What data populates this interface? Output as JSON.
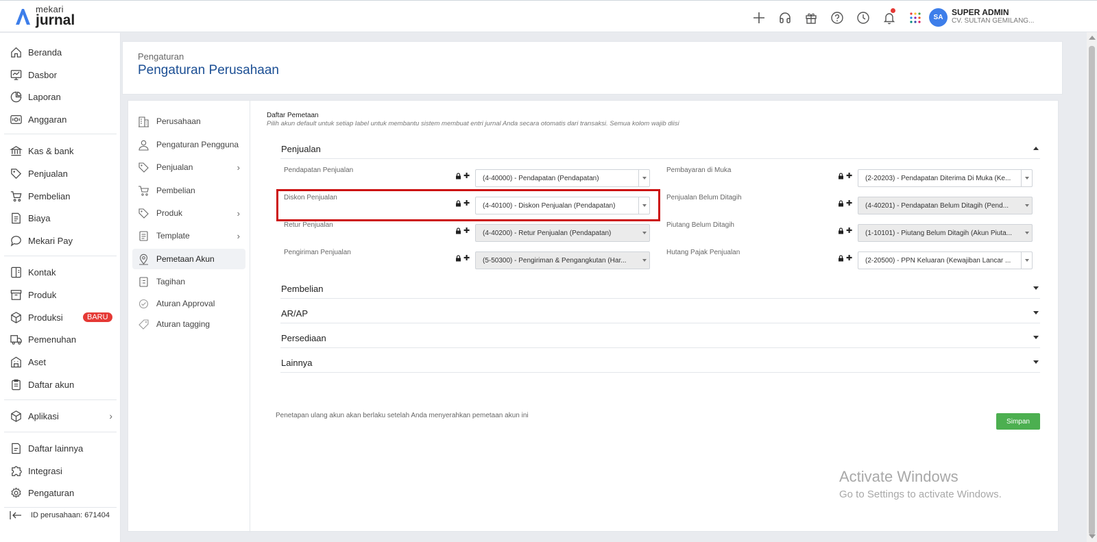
{
  "app": {
    "logo_small": "mekari",
    "logo_big": "jurnal"
  },
  "topbar": {
    "icons": [
      "plus-icon",
      "headset-icon",
      "gift-icon",
      "help-icon",
      "clock-icon",
      "bell-icon",
      "apps-grid-icon"
    ],
    "avatar_initials": "SA",
    "user_name": "SUPER ADMIN",
    "company_name": "CV. SULTAN GEMILANG..."
  },
  "sidebar": {
    "items": [
      {
        "label": "Beranda",
        "icon": "home-icon"
      },
      {
        "label": "Dasbor",
        "icon": "dashboard-icon"
      },
      {
        "label": "Laporan",
        "icon": "report-icon"
      },
      {
        "label": "Anggaran",
        "icon": "budget-icon"
      },
      {
        "label": "Kas & bank",
        "icon": "bank-icon"
      },
      {
        "label": "Penjualan",
        "icon": "sales-tag-icon"
      },
      {
        "label": "Pembelian",
        "icon": "cart-icon"
      },
      {
        "label": "Biaya",
        "icon": "expense-icon"
      },
      {
        "label": "Mekari Pay",
        "icon": "chat-pay-icon"
      },
      {
        "label": "Kontak",
        "icon": "contact-book-icon"
      },
      {
        "label": "Produk",
        "icon": "product-box-icon"
      },
      {
        "label": "Produksi",
        "icon": "production-cube-icon",
        "badge": "BARU"
      },
      {
        "label": "Pemenuhan",
        "icon": "truck-icon"
      },
      {
        "label": "Aset",
        "icon": "asset-building-icon"
      },
      {
        "label": "Daftar akun",
        "icon": "account-list-icon"
      },
      {
        "label": "Aplikasi",
        "icon": "apps-cube-icon"
      },
      {
        "label": "Daftar lainnya",
        "icon": "other-list-icon"
      },
      {
        "label": "Integrasi",
        "icon": "integration-icon"
      },
      {
        "label": "Pengaturan",
        "icon": "settings-gear-icon"
      }
    ],
    "company_id": "ID perusahaan: 671404"
  },
  "header": {
    "breadcrumb": "Pengaturan",
    "title": "Pengaturan Perusahaan"
  },
  "settings_menu": [
    {
      "label": "Perusahaan"
    },
    {
      "label": "Pengaturan Pengguna"
    },
    {
      "label": "Penjualan"
    },
    {
      "label": "Pembelian"
    },
    {
      "label": "Produk"
    },
    {
      "label": "Template"
    },
    {
      "label": "Pemetaan Akun"
    },
    {
      "label": "Tagihan"
    },
    {
      "label": "Aturan Approval"
    },
    {
      "label": "Aturan tagging"
    }
  ],
  "mapping": {
    "title": "Daftar Pemetaan",
    "subtitle": "Pilih akun default untuk setiap label untuk membantu sistem membuat entri jurnal Anda secara otomatis dari transaksi. Semua kolom wajib diisi",
    "sections": [
      "Penjualan",
      "Pembelian",
      "AR/AP",
      "Persediaan",
      "Lainnya"
    ],
    "penjualan_rows": [
      {
        "left_label": "Pendapatan Penjualan",
        "left_value": "(4-40000) - Pendapatan (Pendapatan)",
        "right_label": "Pembayaran di Muka",
        "right_value": "(2-20203) - Pendapatan Diterima Di Muka (Ke..."
      },
      {
        "left_label": "Diskon Penjualan",
        "left_value": "(4-40100) - Diskon Penjualan (Pendapatan)",
        "right_label": "Penjualan Belum Ditagih",
        "right_value": "(4-40201) - Pendapatan Belum Ditagih (Pend..."
      },
      {
        "left_label": "Retur Penjualan",
        "left_value": "(4-40200) - Retur Penjualan (Pendapatan)",
        "right_label": "Piutang Belum Ditagih",
        "right_value": "(1-10101) - Piutang Belum Ditagih (Akun Piuta..."
      },
      {
        "left_label": "Pengiriman Penjualan",
        "left_value": "(5-50300) - Pengiriman & Pengangkutan (Har...",
        "right_label": "Hutang Pajak Penjualan",
        "right_value": "(2-20500) - PPN Keluaran (Kewajiban Lancar ..."
      }
    ],
    "footnote": "Penetapan ulang akun akan berlaku setelah Anda menyerahkan pemetaan akun ini",
    "save_label": "Simpan"
  },
  "watermark": {
    "line1": "Activate Windows",
    "line2": "Go to Settings to activate Windows."
  },
  "colors": {
    "brand_blue": "#1c4f94",
    "save_green": "#4caf50",
    "badge_red": "#e53935",
    "highlight_red": "#cc1111"
  }
}
